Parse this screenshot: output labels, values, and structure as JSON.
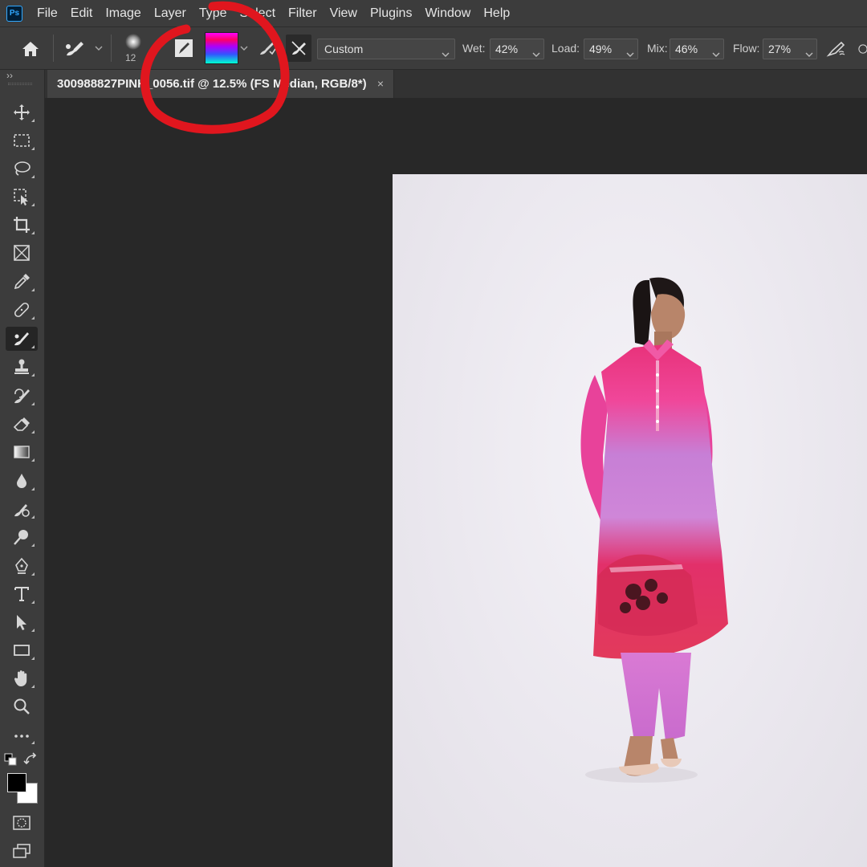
{
  "app": {
    "logo_text": "Ps",
    "menu": [
      "File",
      "Edit",
      "Image",
      "Layer",
      "Type",
      "Select",
      "Filter",
      "View",
      "Plugins",
      "Window",
      "Help"
    ]
  },
  "options_bar": {
    "brush_size": "12",
    "preset": "Custom",
    "wet_label": "Wet:",
    "wet_value": "42%",
    "load_label": "Load:",
    "load_value": "49%",
    "mix_label": "Mix:",
    "mix_value": "46%",
    "flow_label": "Flow:",
    "flow_value": "27%",
    "swatch_colors": [
      "#ff00ff",
      "#ff0066",
      "#aa00ff",
      "#3355ff",
      "#00ffd0"
    ]
  },
  "document": {
    "tab_title": "300988827PINK_0056.tif @ 12.5% (FS Median, RGB/8*)",
    "close_symbol": "×"
  },
  "toolbar": {
    "collapse_symbol": "››",
    "tools": [
      "move-tool",
      "marquee-tool",
      "lasso-tool",
      "object-selection-tool",
      "crop-tool",
      "frame-tool",
      "eyedropper-tool",
      "healing-brush-tool",
      "mixer-brush-tool",
      "clone-stamp-tool",
      "history-brush-tool",
      "eraser-tool",
      "gradient-tool",
      "blur-tool",
      "dodge-tool",
      "pen-tool",
      "type-tool",
      "path-selection-tool",
      "rectangle-tool",
      "hand-tool",
      "zoom-tool",
      "edit-toolbar"
    ],
    "foreground_color": "#000000",
    "background_color": "#ffffff"
  },
  "annotation": {
    "color": "#e0161e",
    "shape": "hand-drawn circle"
  }
}
